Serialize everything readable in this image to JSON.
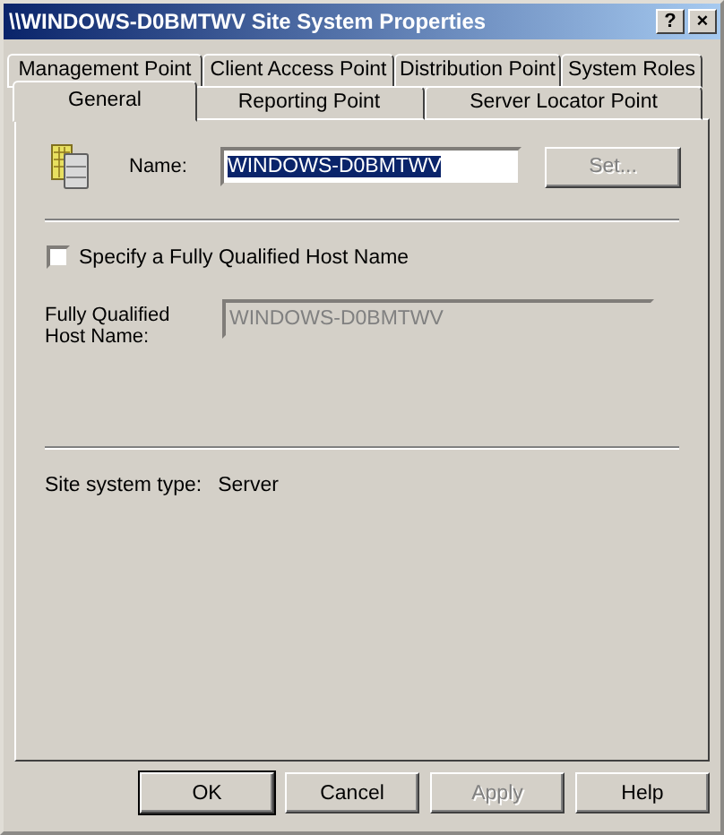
{
  "window": {
    "title": "\\\\WINDOWS-D0BMTWV Site System Properties",
    "help_button": "?",
    "close_button": "×"
  },
  "tab_rows": [
    [
      {
        "label": "Management Point",
        "selected": false
      },
      {
        "label": "Client Access Point",
        "selected": false
      },
      {
        "label": "Distribution Point",
        "selected": false
      },
      {
        "label": "System Roles",
        "selected": false
      }
    ],
    [
      {
        "label": "General",
        "selected": true
      },
      {
        "label": "Reporting Point",
        "selected": false
      },
      {
        "label": "Server Locator Point",
        "selected": false
      }
    ]
  ],
  "name": {
    "label": "Name:",
    "value": "WINDOWS-D0BMTWV",
    "text_selected": true
  },
  "set_button": {
    "label": "Set...",
    "disabled": true
  },
  "fqdn_checkbox": {
    "label": "Specify a Fully Qualified Host Name",
    "checked": false
  },
  "fqdn_field": {
    "label": "Fully Qualified Host Name:",
    "value": "WINDOWS-D0BMTWV",
    "disabled": true
  },
  "site_system_type": {
    "label": "Site system type:",
    "value": "Server"
  },
  "buttons": [
    {
      "label": "OK",
      "default": true,
      "disabled": false
    },
    {
      "label": "Cancel",
      "default": false,
      "disabled": false
    },
    {
      "label": "Apply",
      "default": false,
      "disabled": true
    },
    {
      "label": "Help",
      "default": false,
      "disabled": false
    }
  ]
}
